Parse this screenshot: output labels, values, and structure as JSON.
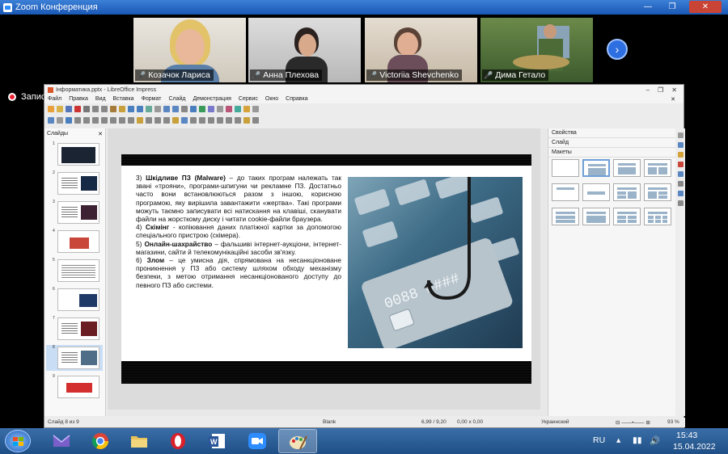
{
  "zoom": {
    "title": "Zoom Конференция",
    "recording_label": "Запис",
    "participants": [
      {
        "name": "Козачок Лариса"
      },
      {
        "name": "Анна Плехова"
      },
      {
        "name": "Victoriia Shevchenko"
      },
      {
        "name": "Дима Гетало"
      }
    ],
    "next_arrow": "›"
  },
  "libreoffice": {
    "title": "Інформатика.pptx - LibreOffice Impress",
    "menu": [
      "Файл",
      "Правка",
      "Вид",
      "Вставка",
      "Формат",
      "Слайд",
      "Демонстрация",
      "Сервис",
      "Окно",
      "Справка"
    ],
    "slides_panel_title": "Слайды",
    "properties_title": "Свойства",
    "slide_section": "Слайд",
    "layouts_section": "Макеты",
    "slide_count": 9,
    "selected_slide": 8,
    "slide_content": {
      "items": [
        {
          "num": "3)",
          "bold": "Шкідливе ПЗ (Malware)",
          "text": " – до таких програм належать так звані «трояни», програми-шпигуни чи рекламне ПЗ. Достатньо часто вони встановлюються разом з іншою, корисною програмою, яку вирішила завантажити «жертва». Такі програми можуть таємно записувати всі натискання на клавіші, сканувати файли на жорсткому диску і читати cookie-файли браузера."
        },
        {
          "num": "4)",
          "bold": "Скімінг",
          "text": " - копіювання даних платіжної картки за допомогою спеціального пристрою (скімера)."
        },
        {
          "num": "5)",
          "bold": "Онлайн-шахрайство",
          "text": " – фальшиві інтернет-аукціони, інтернет-магазини, сайти й телекомунікаційні засоби зв'язку."
        },
        {
          "num": "6)",
          "bold": "Злом",
          "text": " – це умисна дія, спрямована на несанкціоноване проникнення у ПЗ або систему шляхом обходу механізму безпеки, з метою отримання несанкціонованого доступу до певного ПЗ або системи."
        }
      ]
    },
    "status": {
      "slide_info": "Слайд 8 из 9",
      "layout": "Blank",
      "position": "6,99 / 9,20",
      "size": "0,00 x 0,00",
      "language": "Украинский",
      "zoom": "93 %"
    }
  },
  "taskbar": {
    "language": "RU",
    "time": "15:43",
    "date": "15.04.2022"
  }
}
